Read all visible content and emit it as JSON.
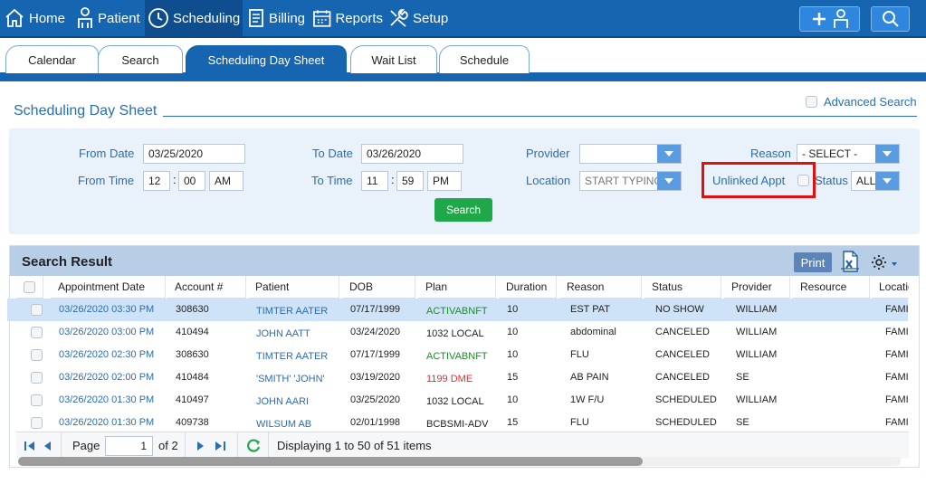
{
  "nav": {
    "items": [
      {
        "label": "Home",
        "icon": "home-icon"
      },
      {
        "label": "Patient",
        "icon": "patient-icon"
      },
      {
        "label": "Scheduling",
        "icon": "clock-icon"
      },
      {
        "label": "Billing",
        "icon": "billing-icon"
      },
      {
        "label": "Reports",
        "icon": "calendar-icon"
      },
      {
        "label": "Setup",
        "icon": "tools-icon"
      }
    ],
    "active": "Scheduling"
  },
  "tabs": [
    "Calendar",
    "Search",
    "Scheduling Day Sheet",
    "Wait List",
    "Schedule"
  ],
  "page": {
    "title": "Scheduling Day Sheet",
    "advanced_search_label": "Advanced Search"
  },
  "filters": {
    "from_date_label": "From Date",
    "from_date": "03/25/2020",
    "to_date_label": "To Date",
    "to_date": "03/26/2020",
    "provider_label": "Provider",
    "provider_value": "",
    "reason_label": "Reason",
    "reason_value": "- SELECT -",
    "from_time_label": "From Time",
    "from_hour": "12",
    "from_min": "00",
    "from_ampm": "AM",
    "to_time_label": "To Time",
    "to_hour": "11",
    "to_min": "59",
    "to_ampm": "PM",
    "location_label": "Location",
    "location_placeholder": "START TYPING",
    "unlinked_label": "Unlinked Appt",
    "status_label": "Status",
    "status_value": "ALL",
    "search_button": "Search"
  },
  "grid": {
    "title": "Search Result",
    "print_label": "Print",
    "columns": [
      "Appointment Date",
      "Account #",
      "Patient",
      "DOB",
      "Plan",
      "Duration",
      "Reason",
      "Status",
      "Provider",
      "Resource",
      "Location"
    ],
    "rows": [
      {
        "date": "03/26/2020 03:30 PM",
        "account": "308630",
        "patient": "TIMTER AATER",
        "dob": "07/17/1999",
        "plan": "ACTIVABNFT",
        "plan_color": "green",
        "duration": "10",
        "reason": "EST PAT",
        "status": "NO SHOW",
        "provider": "WILLIAM",
        "resource": "",
        "location": "FAMI"
      },
      {
        "date": "03/26/2020 03:00 PM",
        "account": "410494",
        "patient": "JOHN AATT",
        "dob": "03/24/2020",
        "plan": "1032 LOCAL",
        "plan_color": "normal",
        "duration": "10",
        "reason": "abdominal",
        "status": "CANCELED",
        "provider": "WILLIAM",
        "resource": "",
        "location": "FAMI"
      },
      {
        "date": "03/26/2020 02:30 PM",
        "account": "308630",
        "patient": "TIMTER AATER",
        "dob": "07/17/1999",
        "plan": "ACTIVABNFT",
        "plan_color": "green",
        "duration": "10",
        "reason": "FLU",
        "status": "CANCELED",
        "provider": "WILLIAM",
        "resource": "",
        "location": "FAMI"
      },
      {
        "date": "03/26/2020 02:00 PM",
        "account": "410484",
        "patient": "'SMITH' 'JOHN'",
        "dob": "03/19/2020",
        "plan": "1199 DME",
        "plan_color": "red",
        "duration": "15",
        "reason": "AB PAIN",
        "status": "CANCELED",
        "provider": "SE",
        "resource": "",
        "location": "FAMI"
      },
      {
        "date": "03/26/2020 01:30 PM",
        "account": "410497",
        "patient": "JOHN AARI",
        "dob": "03/25/2020",
        "plan": "1032 LOCAL",
        "plan_color": "normal",
        "duration": "10",
        "reason": "1W F/U",
        "status": "SCHEDULED",
        "provider": "WILLIAM",
        "resource": "",
        "location": "FAMI"
      },
      {
        "date": "03/26/2020 01:30 PM",
        "account": "409738",
        "patient": "WILSUM AB",
        "dob": "02/01/1998",
        "plan": "BCBSMI-ADV",
        "plan_color": "normal",
        "duration": "15",
        "reason": "FLU",
        "status": "SCHEDULED",
        "provider": "SE",
        "resource": "",
        "location": "FAMI"
      }
    ],
    "pager": {
      "page_label": "Page",
      "page_value": "1",
      "of_label": "of 2",
      "display_text": "Displaying 1 to 50 of 51 items"
    }
  }
}
